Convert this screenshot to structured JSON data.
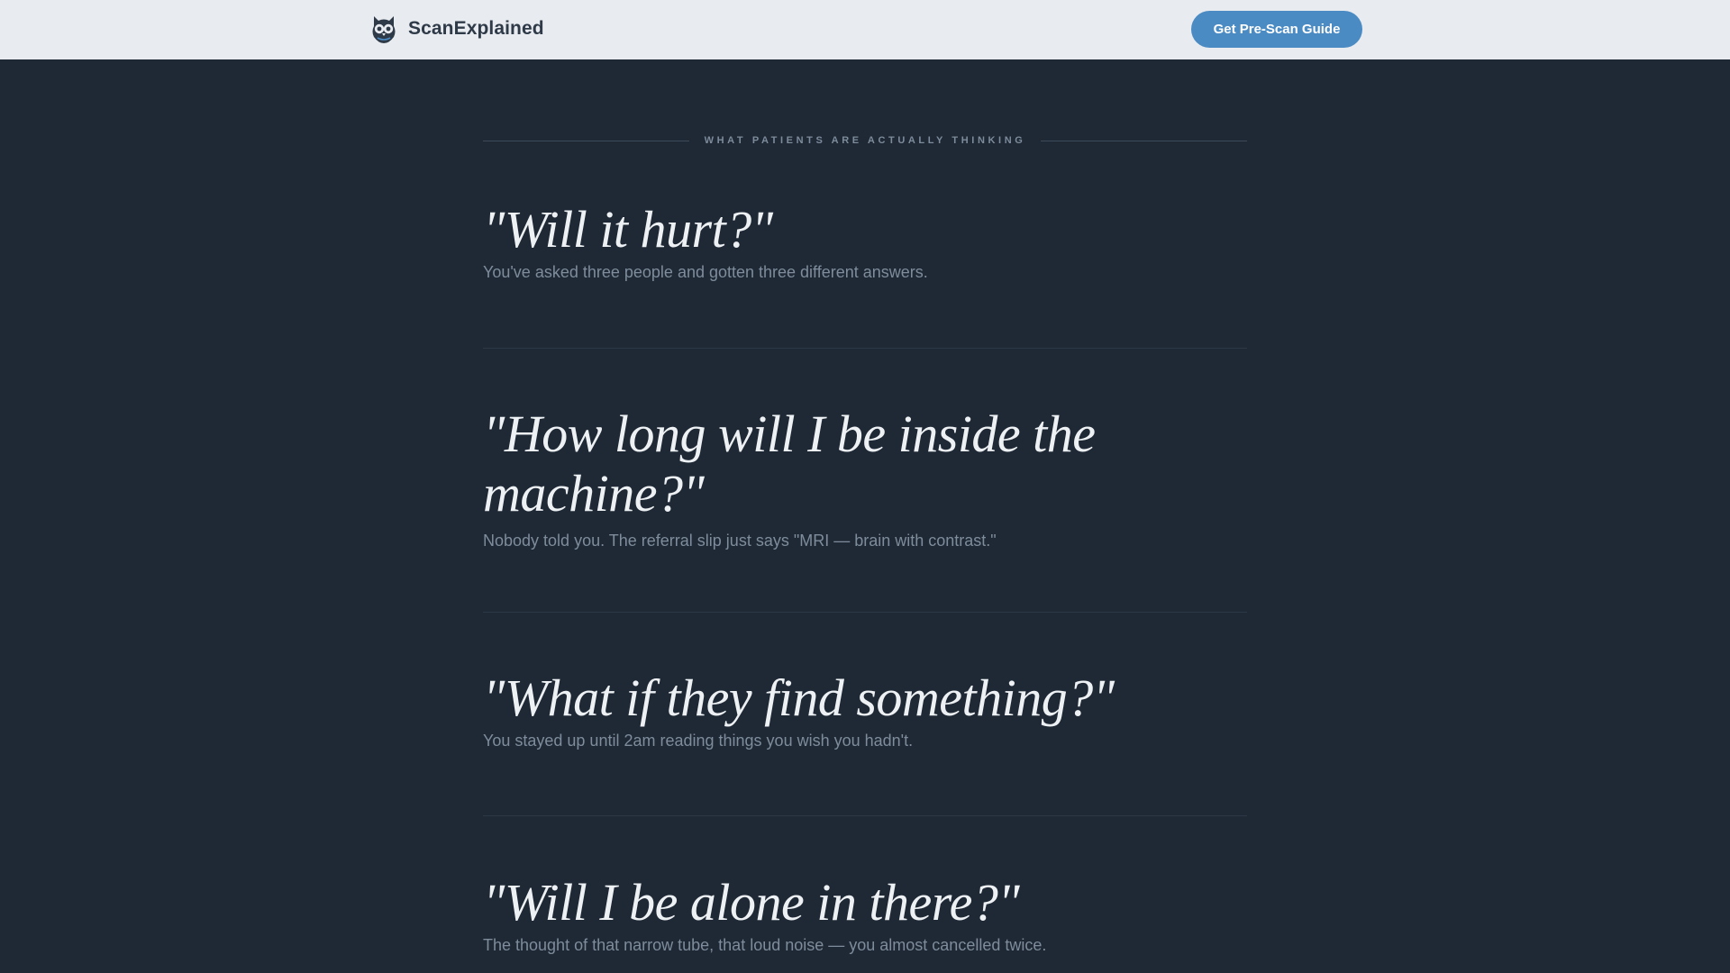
{
  "header": {
    "brand_name": "ScanExplained",
    "cta_label": "Get Pre-Scan Guide",
    "logo_icon": "owl-logo-icon"
  },
  "section": {
    "eyebrow": "WHAT PATIENTS ARE ACTUALLY THINKING",
    "items": [
      {
        "quote": "\"Will it hurt?\"",
        "sub": "You've asked three people and gotten three different answers."
      },
      {
        "quote": "\"How long will I be inside the machine?\"",
        "sub": "Nobody told you. The referral slip just says \"MRI — brain with contrast.\""
      },
      {
        "quote": "\"What if they find something?\"",
        "sub": "You stayed up until 2am reading things you wish you hadn't."
      },
      {
        "quote": "\"Will I be alone in there?\"",
        "sub": "The thought of that narrow tube, that loud noise — you almost cancelled twice."
      }
    ]
  },
  "colors": {
    "background": "#1f2935",
    "topbar": "#e8ebef",
    "accent": "#4a8bc4",
    "quote_text": "#eef1f4",
    "sub_text": "#7e8c9b"
  }
}
